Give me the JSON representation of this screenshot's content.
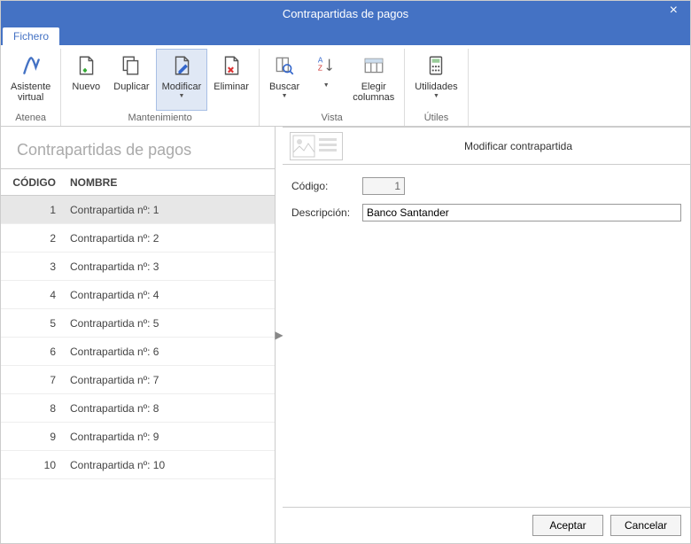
{
  "window": {
    "title": "Contrapartidas de pagos"
  },
  "tabs": {
    "file": "Fichero"
  },
  "ribbon": {
    "groups": {
      "atenea": {
        "label": "Atenea"
      },
      "mantenimiento": {
        "label": "Mantenimiento"
      },
      "vista": {
        "label": "Vista"
      },
      "utiles": {
        "label": "Útiles"
      }
    },
    "buttons": {
      "asistente": "Asistente\nvirtual",
      "nuevo": "Nuevo",
      "duplicar": "Duplicar",
      "modificar": "Modificar",
      "eliminar": "Eliminar",
      "buscar": "Buscar",
      "sort": "",
      "columnas": "Elegir\ncolumnas",
      "utilidades": "Utilidades"
    }
  },
  "list": {
    "title": "Contrapartidas de pagos",
    "columns": {
      "code": "CÓDIGO",
      "name": "NOMBRE"
    },
    "rows": [
      {
        "code": "1",
        "name": "Contrapartida nº: 1",
        "selected": true
      },
      {
        "code": "2",
        "name": "Contrapartida nº: 2"
      },
      {
        "code": "3",
        "name": "Contrapartida nº: 3"
      },
      {
        "code": "4",
        "name": "Contrapartida nº: 4"
      },
      {
        "code": "5",
        "name": "Contrapartida nº: 5"
      },
      {
        "code": "6",
        "name": "Contrapartida nº: 6"
      },
      {
        "code": "7",
        "name": "Contrapartida nº: 7"
      },
      {
        "code": "8",
        "name": "Contrapartida nº: 8"
      },
      {
        "code": "9",
        "name": "Contrapartida nº: 9"
      },
      {
        "code": "10",
        "name": "Contrapartida nº: 10"
      }
    ]
  },
  "form": {
    "title": "Modificar contrapartida",
    "labels": {
      "code": "Código:",
      "desc": "Descripción:"
    },
    "values": {
      "code": "1",
      "desc": "Banco Santander"
    }
  },
  "buttons": {
    "accept": "Aceptar",
    "cancel": "Cancelar"
  }
}
